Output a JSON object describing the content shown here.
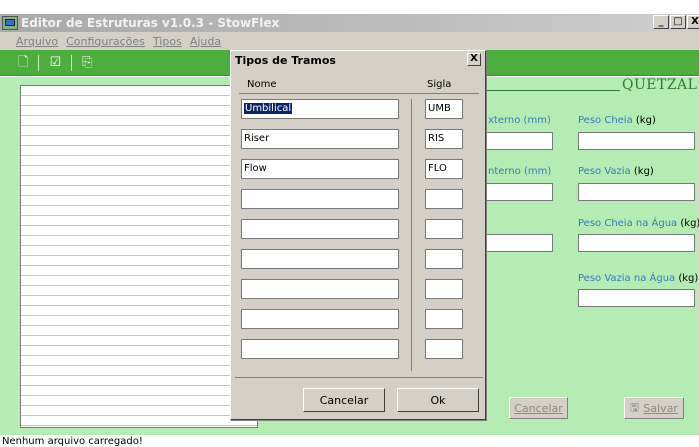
{
  "window": {
    "title": "Editor de Estruturas v1.0.3 - StowFlex",
    "controls": {
      "minimize": "_",
      "maximize": "□",
      "close": "X"
    }
  },
  "menu": [
    "Arquivo",
    "Configurações",
    "Tipos",
    "Ajuda"
  ],
  "toolbar": {
    "icons": [
      "new-document-icon",
      "edit-icon",
      "copy-icon"
    ]
  },
  "brand": "QUETZAL",
  "form": {
    "diam_externo": "xterno (mm)",
    "diam_interno": "nterno (mm)",
    "peso_cheia": "Peso Cheia",
    "peso_vazia": "Peso Vazia",
    "peso_cheia_agua": "Peso Cheia na Água",
    "peso_vazia_agua": "Peso Vazia na Água",
    "unit": "(kg)",
    "cancel_button": "Cancelar",
    "save_button": "Salvar"
  },
  "status": "Nenhum arquivo carregado!",
  "dialog": {
    "title": "Tipos de Tramos",
    "close": "X",
    "col_nome": "Nome",
    "col_sigla": "Sigla",
    "rows": [
      {
        "nome": "Umbilical",
        "sigla": "UMB"
      },
      {
        "nome": "Riser",
        "sigla": "RIS"
      },
      {
        "nome": "Flow",
        "sigla": "FLO"
      },
      {
        "nome": "",
        "sigla": ""
      },
      {
        "nome": "",
        "sigla": ""
      },
      {
        "nome": "",
        "sigla": ""
      },
      {
        "nome": "",
        "sigla": ""
      },
      {
        "nome": "",
        "sigla": ""
      },
      {
        "nome": "",
        "sigla": ""
      }
    ],
    "cancel_button": "Cancelar",
    "ok_button": "Ok"
  },
  "colors": {
    "toolbar": "#4cae3c",
    "client": "#b4ecb4",
    "label": "#3a7abf",
    "brand": "#2e7d2e"
  }
}
